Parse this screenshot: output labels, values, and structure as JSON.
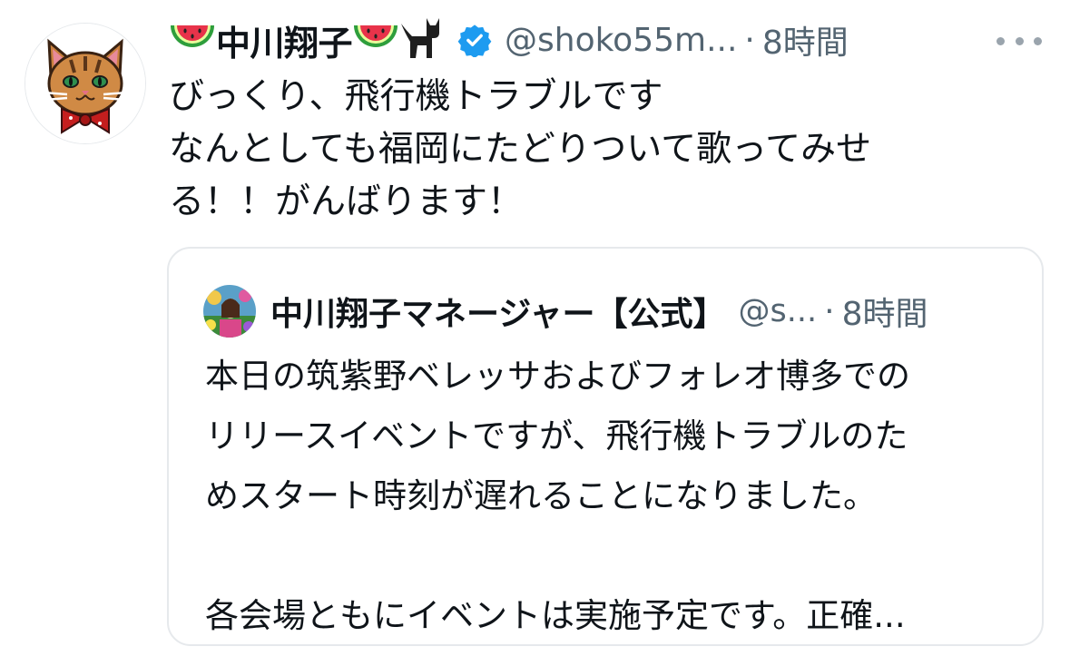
{
  "tweet": {
    "author_name": "中川翔子",
    "name_emojis": [
      "watermelon-emoji",
      "watermelon-emoji",
      "black-cat-emoji"
    ],
    "verified": true,
    "handle": "@shoko55m...",
    "separator": "·",
    "time": "8時間",
    "text_lines": [
      "びっくり、飛行機トラブルです",
      "なんとしても福岡にたどりついて歌ってみせ",
      "る！！がんばります！"
    ]
  },
  "quote": {
    "author_name": "中川翔子マネージャー【公式】",
    "handle": "@s...",
    "separator": "·",
    "time": "8時間",
    "text_lines": [
      "本日の筑紫野ベレッサおよびフォレオ博多での",
      "リリースイベントですが、飛行機トラブルのた",
      "めスタート時刻が遅れることになりました。",
      "",
      "各会場ともにイベントは実施予定です。正確..."
    ]
  },
  "colors": {
    "text": "#0f1419",
    "secondary": "#536471",
    "border": "#e6e9ec",
    "verified_blue": "#1d9bf0"
  }
}
